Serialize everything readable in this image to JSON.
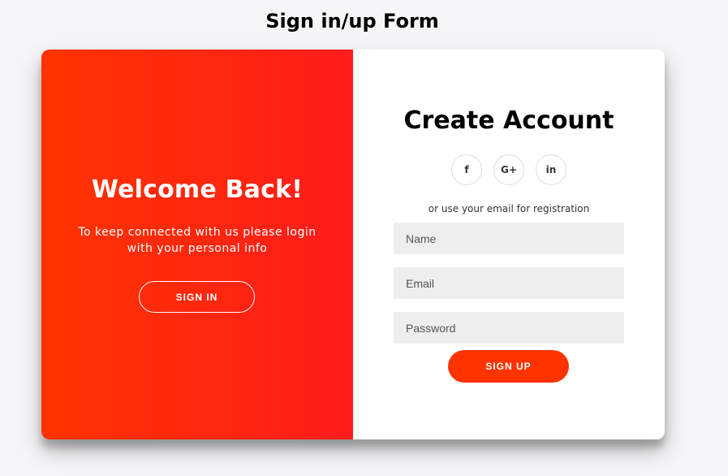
{
  "page": {
    "title": "Sign in/up Form"
  },
  "overlay": {
    "title": "Welcome Back!",
    "text": "To keep connected with us please login with your personal info",
    "button_label": "SIGN IN",
    "gradient_start": "#ff3300",
    "gradient_end": "#ff1c1c"
  },
  "form": {
    "title": "Create Account",
    "social": [
      {
        "icon": "facebook-icon",
        "glyph": "f"
      },
      {
        "icon": "google-plus-icon",
        "glyph": "G+"
      },
      {
        "icon": "linkedin-icon",
        "glyph": "in"
      }
    ],
    "subtitle": "or use your email for registration",
    "fields": {
      "name": {
        "placeholder": "Name",
        "value": ""
      },
      "email": {
        "placeholder": "Email",
        "value": ""
      },
      "password": {
        "placeholder": "Password",
        "value": ""
      }
    },
    "button_label": "SIGN UP",
    "accent": "#ff3300"
  }
}
